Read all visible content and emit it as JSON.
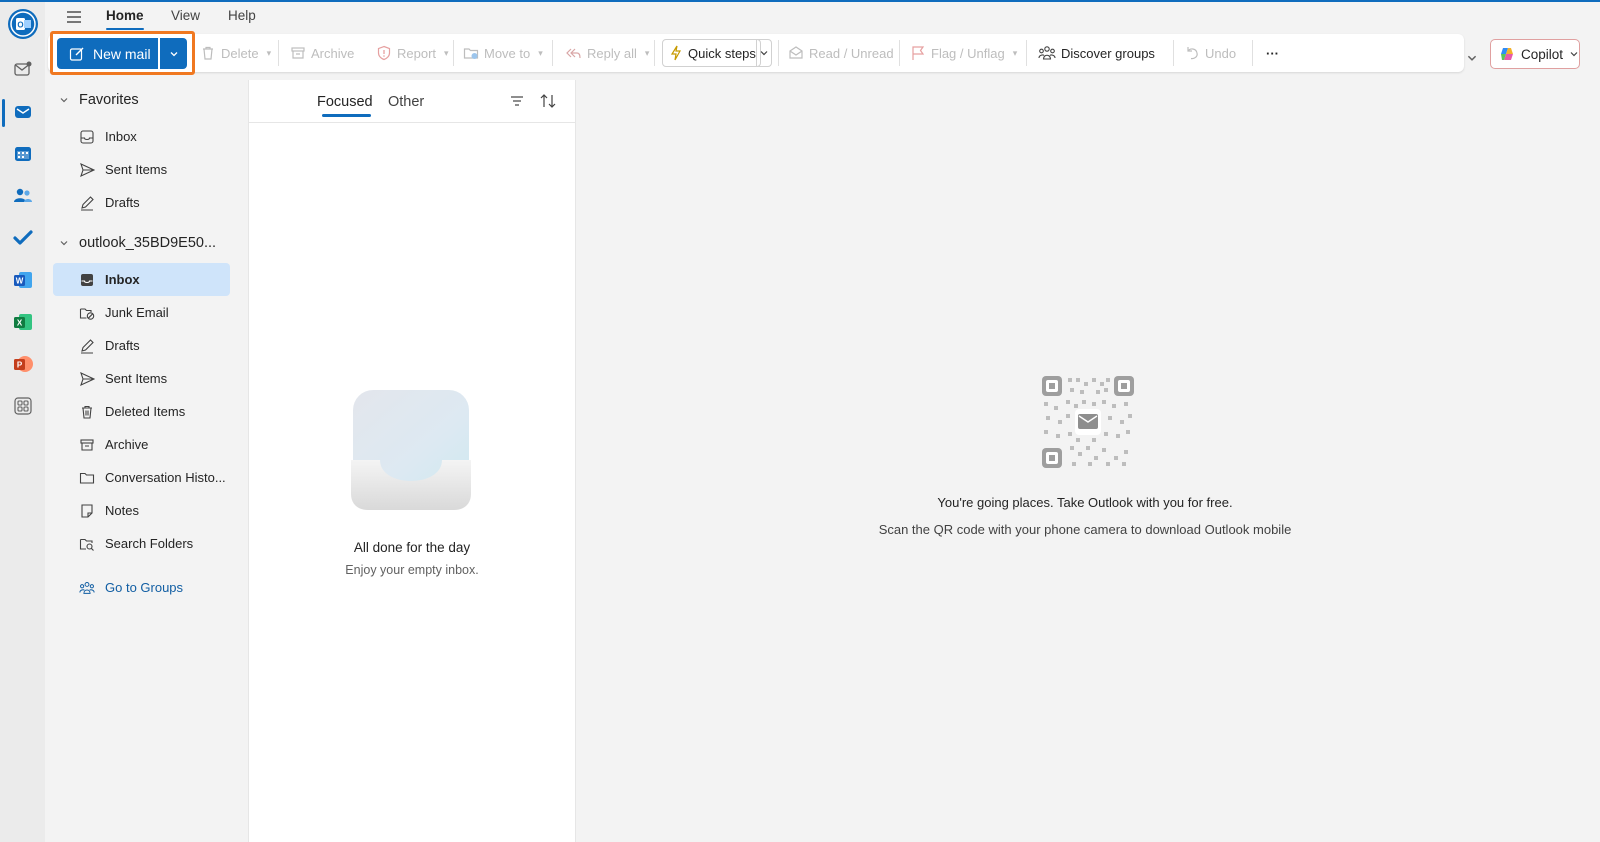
{
  "menu": {
    "home": "Home",
    "view": "View",
    "help": "Help"
  },
  "toolbar": {
    "new_mail": "New mail",
    "delete": "Delete",
    "archive": "Archive",
    "report": "Report",
    "move_to": "Move to",
    "reply_all": "Reply all",
    "quick_steps": "Quick steps",
    "read_unread": "Read / Unread",
    "flag_unflag": "Flag / Unflag",
    "discover_groups": "Discover groups",
    "undo": "Undo",
    "more": "···",
    "copilot": "Copilot"
  },
  "folders": {
    "favorites_header": "Favorites",
    "favorites": [
      {
        "label": "Inbox",
        "icon": "inbox-icon"
      },
      {
        "label": "Sent Items",
        "icon": "send-icon"
      },
      {
        "label": "Drafts",
        "icon": "pencil-icon"
      }
    ],
    "account_header": "outlook_35BD9E50...",
    "account": [
      {
        "label": "Inbox",
        "icon": "inbox-icon",
        "selected": true
      },
      {
        "label": "Junk Email",
        "icon": "junk-icon"
      },
      {
        "label": "Drafts",
        "icon": "pencil-icon"
      },
      {
        "label": "Sent Items",
        "icon": "send-icon"
      },
      {
        "label": "Deleted Items",
        "icon": "trash-icon"
      },
      {
        "label": "Archive",
        "icon": "archive-icon"
      },
      {
        "label": "Conversation Histo...",
        "icon": "folder-icon"
      },
      {
        "label": "Notes",
        "icon": "note-icon"
      },
      {
        "label": "Search Folders",
        "icon": "search-folder-icon"
      }
    ],
    "go_to_groups": "Go to Groups"
  },
  "message_list": {
    "tab_focused": "Focused",
    "tab_other": "Other",
    "empty_title": "All done for the day",
    "empty_subtitle": "Enjoy your empty inbox."
  },
  "reading_pane": {
    "promo_title": "You're going places. Take Outlook with you for free.",
    "promo_subtitle": "Scan the QR code with your phone camera to download Outlook mobile"
  },
  "colors": {
    "accent": "#0f6cbd",
    "highlight": "#f07820",
    "selected": "#cfe4fa"
  }
}
